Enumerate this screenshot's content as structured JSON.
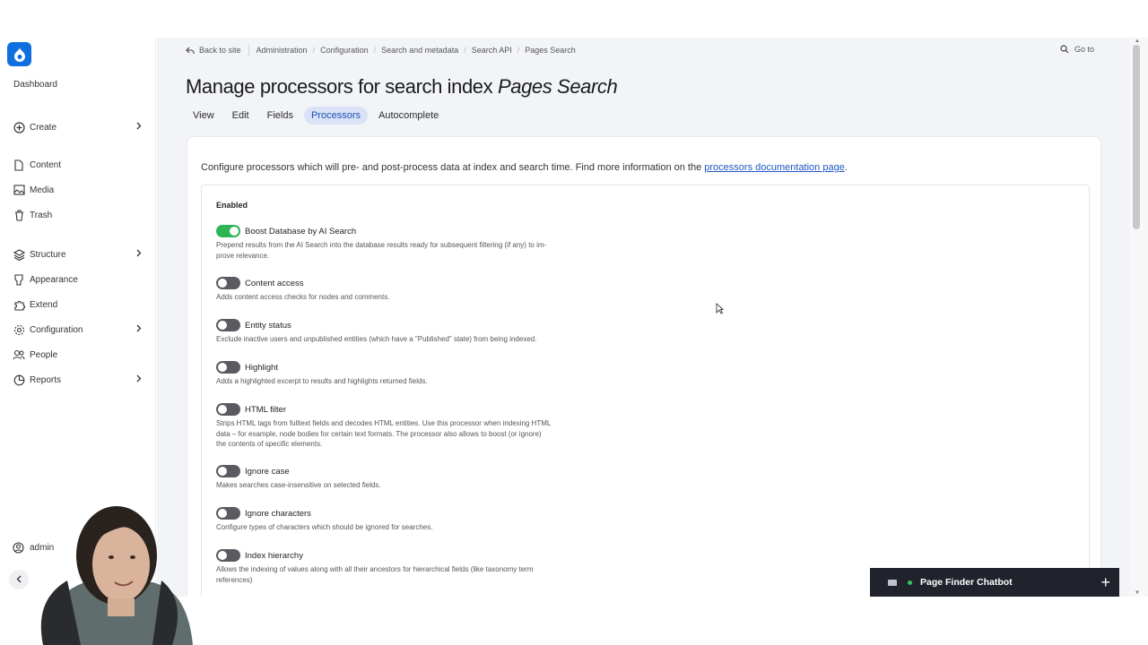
{
  "sidebar": {
    "dashboard": "Dashboard",
    "items": [
      {
        "label": "Create",
        "icon": "plus-circle-icon",
        "has_children": true
      },
      {
        "label": "Content",
        "icon": "document-icon",
        "has_children": false
      },
      {
        "label": "Media",
        "icon": "image-icon",
        "has_children": false
      },
      {
        "label": "Trash",
        "icon": "trash-icon",
        "has_children": false
      },
      {
        "label": "Structure",
        "icon": "layers-icon",
        "has_children": true
      },
      {
        "label": "Appearance",
        "icon": "brush-icon",
        "has_children": false
      },
      {
        "label": "Extend",
        "icon": "puzzle-icon",
        "has_children": false
      },
      {
        "label": "Configuration",
        "icon": "gear-icon",
        "has_children": true
      },
      {
        "label": "People",
        "icon": "people-icon",
        "has_children": false
      },
      {
        "label": "Reports",
        "icon": "pie-chart-icon",
        "has_children": true
      }
    ],
    "user": "admin"
  },
  "breadcrumb": {
    "back": "Back to site",
    "items": [
      "Administration",
      "Configuration",
      "Search and metadata",
      "Search API",
      "Pages Search"
    ]
  },
  "goto": "Go to",
  "title": {
    "prefix": "Manage processors for search index ",
    "index_name": "Pages Search"
  },
  "tabs": [
    {
      "label": "View",
      "active": false
    },
    {
      "label": "Edit",
      "active": false
    },
    {
      "label": "Fields",
      "active": false
    },
    {
      "label": "Processors",
      "active": true
    },
    {
      "label": "Autocomplete",
      "active": false
    }
  ],
  "intro": {
    "text": "Configure processors which will pre- and post-process data at index and search time. Find more information on the ",
    "link": "processors documentation page",
    "suffix": "."
  },
  "enabled_legend": "Enabled",
  "processors": [
    {
      "name": "Boost Database by AI Search",
      "enabled": true,
      "desc": "Prepend results from the AI Search into the database results ready for subsequent filtering (if any) to im-\nprove relevance."
    },
    {
      "name": "Content access",
      "enabled": false,
      "desc": "Adds content access checks for nodes and comments."
    },
    {
      "name": "Entity status",
      "enabled": false,
      "desc": "Exclude inactive users and unpublished entities (which have a \"Published\" state) from being indexed."
    },
    {
      "name": "Highlight",
      "enabled": false,
      "desc": "Adds a highlighted excerpt to results and highlights returned fields."
    },
    {
      "name": "HTML filter",
      "enabled": false,
      "desc": "Strips HTML tags from fulltext fields and decodes HTML entities. Use this processor when indexing HTML\ndata – for example, node bodies for certain text formats. The processor also allows to boost (or ignore)\nthe contents of specific elements."
    },
    {
      "name": "Ignore case",
      "enabled": false,
      "desc": "Makes searches case-insensitive on selected fields."
    },
    {
      "name": "Ignore characters",
      "enabled": false,
      "desc": "Configure types of characters which should be ignored for searches."
    },
    {
      "name": "Index hierarchy",
      "enabled": false,
      "desc": "Allows the indexing of values along with all their ancestors for hierarchical fields (like taxonomy term\nreferences)"
    }
  ],
  "chatbot": {
    "title": "Page Finder Chatbot"
  },
  "colors": {
    "accent": "#0f6fde",
    "toggle_on": "#2db454",
    "chatbot_bg": "#20232c"
  }
}
